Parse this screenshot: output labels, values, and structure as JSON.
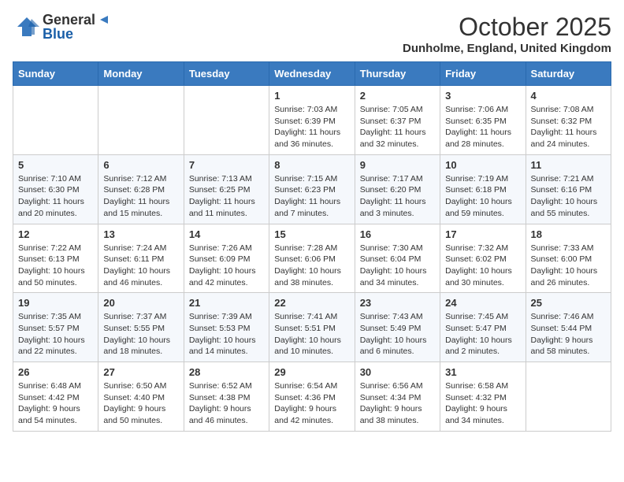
{
  "header": {
    "logo_general": "General",
    "logo_blue": "Blue",
    "month_title": "October 2025",
    "location": "Dunholme, England, United Kingdom"
  },
  "days_of_week": [
    "Sunday",
    "Monday",
    "Tuesday",
    "Wednesday",
    "Thursday",
    "Friday",
    "Saturday"
  ],
  "weeks": [
    [
      {
        "day": "",
        "content": ""
      },
      {
        "day": "",
        "content": ""
      },
      {
        "day": "",
        "content": ""
      },
      {
        "day": "1",
        "content": "Sunrise: 7:03 AM\nSunset: 6:39 PM\nDaylight: 11 hours and 36 minutes."
      },
      {
        "day": "2",
        "content": "Sunrise: 7:05 AM\nSunset: 6:37 PM\nDaylight: 11 hours and 32 minutes."
      },
      {
        "day": "3",
        "content": "Sunrise: 7:06 AM\nSunset: 6:35 PM\nDaylight: 11 hours and 28 minutes."
      },
      {
        "day": "4",
        "content": "Sunrise: 7:08 AM\nSunset: 6:32 PM\nDaylight: 11 hours and 24 minutes."
      }
    ],
    [
      {
        "day": "5",
        "content": "Sunrise: 7:10 AM\nSunset: 6:30 PM\nDaylight: 11 hours and 20 minutes."
      },
      {
        "day": "6",
        "content": "Sunrise: 7:12 AM\nSunset: 6:28 PM\nDaylight: 11 hours and 15 minutes."
      },
      {
        "day": "7",
        "content": "Sunrise: 7:13 AM\nSunset: 6:25 PM\nDaylight: 11 hours and 11 minutes."
      },
      {
        "day": "8",
        "content": "Sunrise: 7:15 AM\nSunset: 6:23 PM\nDaylight: 11 hours and 7 minutes."
      },
      {
        "day": "9",
        "content": "Sunrise: 7:17 AM\nSunset: 6:20 PM\nDaylight: 11 hours and 3 minutes."
      },
      {
        "day": "10",
        "content": "Sunrise: 7:19 AM\nSunset: 6:18 PM\nDaylight: 10 hours and 59 minutes."
      },
      {
        "day": "11",
        "content": "Sunrise: 7:21 AM\nSunset: 6:16 PM\nDaylight: 10 hours and 55 minutes."
      }
    ],
    [
      {
        "day": "12",
        "content": "Sunrise: 7:22 AM\nSunset: 6:13 PM\nDaylight: 10 hours and 50 minutes."
      },
      {
        "day": "13",
        "content": "Sunrise: 7:24 AM\nSunset: 6:11 PM\nDaylight: 10 hours and 46 minutes."
      },
      {
        "day": "14",
        "content": "Sunrise: 7:26 AM\nSunset: 6:09 PM\nDaylight: 10 hours and 42 minutes."
      },
      {
        "day": "15",
        "content": "Sunrise: 7:28 AM\nSunset: 6:06 PM\nDaylight: 10 hours and 38 minutes."
      },
      {
        "day": "16",
        "content": "Sunrise: 7:30 AM\nSunset: 6:04 PM\nDaylight: 10 hours and 34 minutes."
      },
      {
        "day": "17",
        "content": "Sunrise: 7:32 AM\nSunset: 6:02 PM\nDaylight: 10 hours and 30 minutes."
      },
      {
        "day": "18",
        "content": "Sunrise: 7:33 AM\nSunset: 6:00 PM\nDaylight: 10 hours and 26 minutes."
      }
    ],
    [
      {
        "day": "19",
        "content": "Sunrise: 7:35 AM\nSunset: 5:57 PM\nDaylight: 10 hours and 22 minutes."
      },
      {
        "day": "20",
        "content": "Sunrise: 7:37 AM\nSunset: 5:55 PM\nDaylight: 10 hours and 18 minutes."
      },
      {
        "day": "21",
        "content": "Sunrise: 7:39 AM\nSunset: 5:53 PM\nDaylight: 10 hours and 14 minutes."
      },
      {
        "day": "22",
        "content": "Sunrise: 7:41 AM\nSunset: 5:51 PM\nDaylight: 10 hours and 10 minutes."
      },
      {
        "day": "23",
        "content": "Sunrise: 7:43 AM\nSunset: 5:49 PM\nDaylight: 10 hours and 6 minutes."
      },
      {
        "day": "24",
        "content": "Sunrise: 7:45 AM\nSunset: 5:47 PM\nDaylight: 10 hours and 2 minutes."
      },
      {
        "day": "25",
        "content": "Sunrise: 7:46 AM\nSunset: 5:44 PM\nDaylight: 9 hours and 58 minutes."
      }
    ],
    [
      {
        "day": "26",
        "content": "Sunrise: 6:48 AM\nSunset: 4:42 PM\nDaylight: 9 hours and 54 minutes."
      },
      {
        "day": "27",
        "content": "Sunrise: 6:50 AM\nSunset: 4:40 PM\nDaylight: 9 hours and 50 minutes."
      },
      {
        "day": "28",
        "content": "Sunrise: 6:52 AM\nSunset: 4:38 PM\nDaylight: 9 hours and 46 minutes."
      },
      {
        "day": "29",
        "content": "Sunrise: 6:54 AM\nSunset: 4:36 PM\nDaylight: 9 hours and 42 minutes."
      },
      {
        "day": "30",
        "content": "Sunrise: 6:56 AM\nSunset: 4:34 PM\nDaylight: 9 hours and 38 minutes."
      },
      {
        "day": "31",
        "content": "Sunrise: 6:58 AM\nSunset: 4:32 PM\nDaylight: 9 hours and 34 minutes."
      },
      {
        "day": "",
        "content": ""
      }
    ]
  ]
}
